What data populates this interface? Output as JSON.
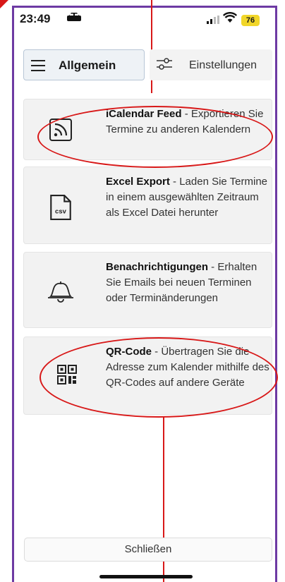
{
  "status_bar": {
    "time": "23:49",
    "battery": "76"
  },
  "header": {
    "general_label": "Allgemein",
    "settings_label": "Einstellungen"
  },
  "cards": [
    {
      "title": "iCalendar Feed",
      "desc": " - Exportieren Sie Termine zu anderen Kalendern",
      "icon": "rss-feed-icon"
    },
    {
      "title": "Excel Export",
      "desc": " - Laden Sie Termine in einem ausgewählten Zeitraum als Excel Datei herunter",
      "icon": "csv-file-icon",
      "icon_text": "csv"
    },
    {
      "title": "Benachrichtigungen",
      "desc": " - Erhalten Sie Emails bei neuen Terminen oder Terminänderungen",
      "icon": "bell-icon"
    },
    {
      "title": "QR-Code",
      "desc": " - Übertragen Sie die Adresse zum Kalender mithilfe des QR-Codes auf andere Geräte",
      "icon": "qr-code-icon"
    }
  ],
  "footer": {
    "close_label": "Schließen"
  },
  "colors": {
    "annotation": "#d81818",
    "frame": "#6d3aa3",
    "battery": "#f1d629"
  }
}
